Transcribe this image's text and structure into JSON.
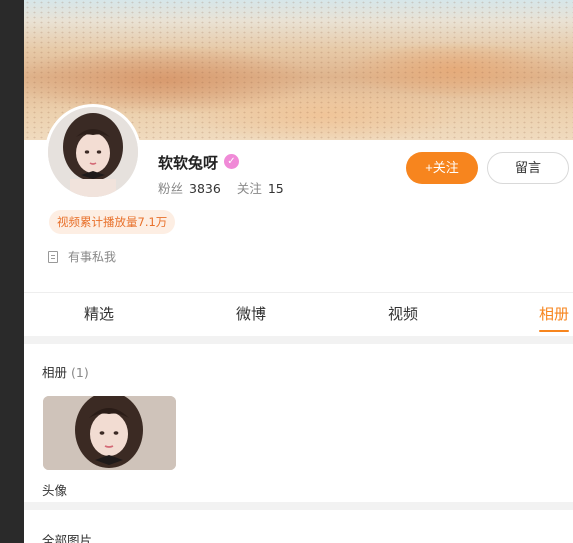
{
  "profile": {
    "username": "软软兔呀",
    "fans_label": "粉丝",
    "fans_count": "3836",
    "following_label": "关注",
    "following_count": "15",
    "views_badge": "视频累计播放量7.1万",
    "dm_text": "有事私我"
  },
  "actions": {
    "follow_label": "+关注",
    "message_label": "留言"
  },
  "tabs": [
    {
      "label": "精选"
    },
    {
      "label": "微博"
    },
    {
      "label": "视频"
    },
    {
      "label": "相册",
      "active": true
    }
  ],
  "albums_section": {
    "title": "相册",
    "count": "(1)",
    "items": [
      {
        "name": "头像"
      }
    ]
  },
  "all_photos_section": {
    "title": "全部图片"
  },
  "colors": {
    "accent": "#f7851e",
    "badge_bg": "#fdeee3",
    "verify": "#f08ad7"
  },
  "icons": {
    "verify": "verified-badge-icon",
    "dm": "document-icon"
  }
}
